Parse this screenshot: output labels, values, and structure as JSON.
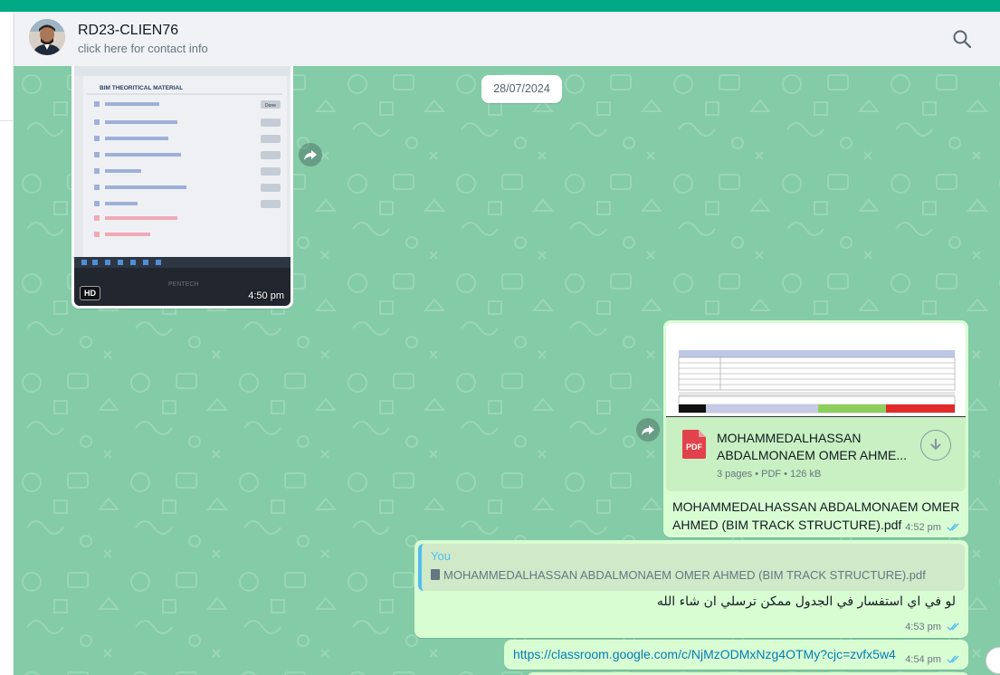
{
  "header": {
    "contact_name": "RD23-CLIEN76",
    "contact_subtitle": "click here for contact info",
    "search_icon": "search-icon"
  },
  "colors": {
    "brand_bar": "#00a884",
    "chat_wallpaper": "#84cba7",
    "outgoing_bubble": "#d9fdd3",
    "link": "#027eb5",
    "read_ticks": "#53bdeb"
  },
  "chat": {
    "date_separator": "28/07/2024",
    "messages": [
      {
        "type": "image",
        "direction": "incoming",
        "badge": "HD",
        "time": "4:50 pm",
        "image_text": {
          "section_title": "BIM THEORITICAL MATERIAL",
          "button": "Done",
          "brand": "PENTECH"
        }
      },
      {
        "type": "document",
        "direction": "outgoing",
        "file_name": "MOHAMMEDALHASSAN ABDALMONAEM OMER AHME...",
        "meta": "3 pages • PDF • 126 kB",
        "file_type": "PDF",
        "caption": "MOHAMMEDALHASSAN ABDALMONAEM OMER AHMED (BIM TRACK STRUCTURE).pdf",
        "time": "4:52 pm",
        "status": "read"
      },
      {
        "type": "reply",
        "direction": "outgoing",
        "quoted_author": "You",
        "quoted_text": "MOHAMMEDALHASSAN ABDALMONAEM OMER AHMED (BIM TRACK STRUCTURE).pdf",
        "text": "لو في اي استفسار في الجدول ممكن ترسلي ان شاء الله",
        "time": "4:53 pm",
        "status": "read"
      },
      {
        "type": "link",
        "direction": "outgoing",
        "text": "https://classroom.google.com/c/NjMzODMxNzg4OTMy?cjc=zvfx5w4",
        "time": "4:54 pm",
        "status": "read"
      }
    ]
  }
}
